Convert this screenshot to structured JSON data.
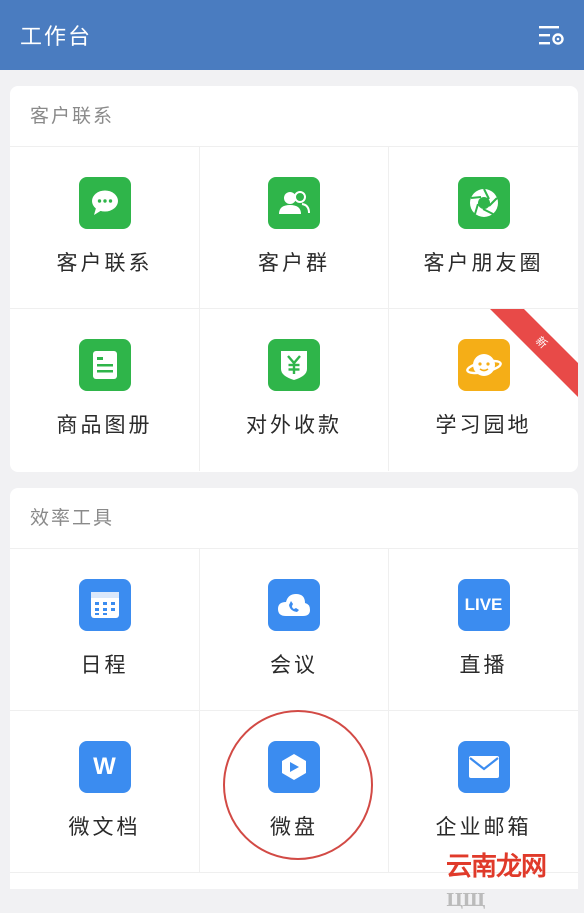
{
  "header": {
    "title": "工作台",
    "settings_icon": "list-settings-icon"
  },
  "sections": [
    {
      "title": "客户联系",
      "items": [
        {
          "label": "客户联系",
          "icon": "chat-bubble-icon",
          "color": "#2fb54a"
        },
        {
          "label": "客户群",
          "icon": "group-icon",
          "color": "#2fb54a"
        },
        {
          "label": "客户朋友圈",
          "icon": "aperture-icon",
          "color": "#2fb54a"
        },
        {
          "label": "商品图册",
          "icon": "catalog-icon",
          "color": "#2fb54a"
        },
        {
          "label": "对外收款",
          "icon": "yuan-shield-icon",
          "color": "#2fb54a"
        },
        {
          "label": "学习园地",
          "icon": "planet-icon",
          "color": "#f5ae17",
          "badge": "新"
        }
      ]
    },
    {
      "title": "效率工具",
      "items": [
        {
          "label": "日程",
          "icon": "calendar-icon",
          "color": "#3b8cf0"
        },
        {
          "label": "会议",
          "icon": "cloud-phone-icon",
          "color": "#3b8cf0"
        },
        {
          "label": "直播",
          "icon": "live-icon",
          "color": "#3b8cf0",
          "icon_text": "LIVE"
        },
        {
          "label": "微文档",
          "icon": "doc-w-icon",
          "color": "#3b8cf0",
          "icon_text": "W"
        },
        {
          "label": "微盘",
          "icon": "drive-icon",
          "color": "#3b8cf0"
        },
        {
          "label": "企业邮箱",
          "icon": "mail-icon",
          "color": "#3b8cf0"
        }
      ]
    }
  ],
  "annotation_color": "#d24a45",
  "watermark": {
    "main": "云南龙网",
    "suffix": "ЦЩ"
  }
}
